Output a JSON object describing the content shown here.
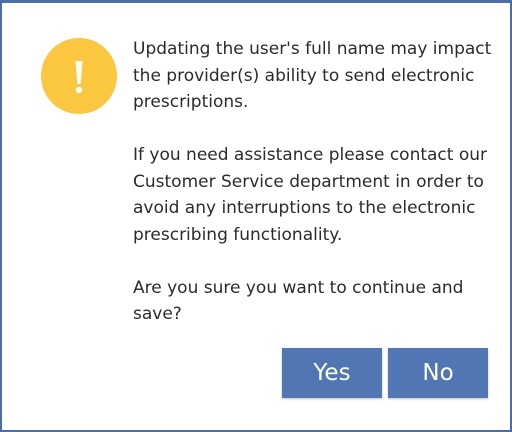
{
  "dialog": {
    "icon": "warning-exclamation-icon",
    "icon_color": "#fbc73e",
    "paragraphs": [
      "Updating the user's full name may impact the provider(s) ability to send electronic prescriptions.",
      "If you need assistance please contact our Customer Service department in order to avoid any interruptions to the electronic prescribing functionality.",
      "Are you sure you want to continue and save?"
    ],
    "buttons": {
      "yes_label": "Yes",
      "no_label": "No",
      "color": "#5077b3"
    }
  }
}
